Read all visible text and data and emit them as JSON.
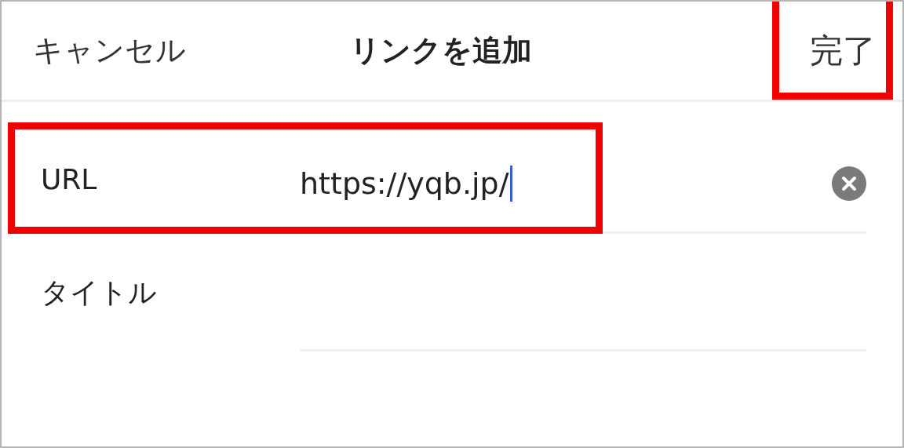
{
  "nav": {
    "cancel": "キャンセル",
    "title": "リンクを追加",
    "done": {
      "label": "完了",
      "highlighted": true
    }
  },
  "fields": [
    {
      "label": "URL",
      "value": "https://yqb.jp/",
      "focused": true,
      "clear_button": true,
      "highlighted": true
    },
    {
      "label": "タイトル",
      "focused": false,
      "clear_button": false,
      "highlighted": false
    }
  ]
}
